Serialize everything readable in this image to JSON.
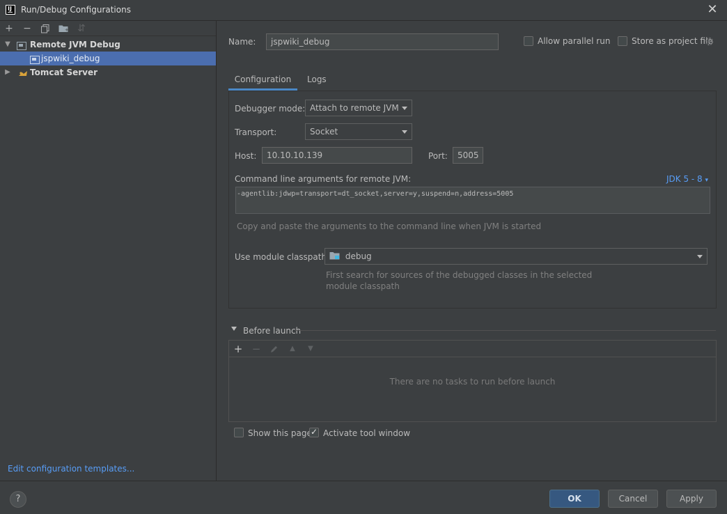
{
  "window": {
    "title": "Run/Debug Configurations",
    "logo_text": "IJ"
  },
  "left": {
    "toolbar": [
      {
        "name": "add-icon",
        "glyph": "+",
        "enabled": true
      },
      {
        "name": "remove-icon",
        "glyph": "−",
        "enabled": true
      },
      {
        "name": "copy-icon",
        "glyph": "⧉",
        "enabled": true
      },
      {
        "name": "folder-icon",
        "glyph": "▣",
        "enabled": true
      },
      {
        "name": "sort-icon",
        "glyph": "⇵",
        "enabled": false
      }
    ],
    "tree": [
      {
        "label": "Remote JVM Debug",
        "bold": true,
        "expanded": true,
        "level": 0,
        "icon": "remote-debug-icon"
      },
      {
        "label": "jspwiki_debug",
        "bold": false,
        "selected": true,
        "level": 1,
        "icon": "config-icon"
      },
      {
        "label": "Tomcat Server",
        "bold": true,
        "expanded": false,
        "level": 0,
        "icon": "tomcat-icon"
      }
    ],
    "edit_templates": "Edit configuration templates..."
  },
  "right": {
    "name_label": "Name:",
    "name_value": "jspwiki_debug",
    "allow_parallel": {
      "label": "Allow parallel run",
      "checked": false
    },
    "store_project": {
      "label": "Store as project file",
      "checked": false
    },
    "tabs": [
      {
        "label": "Configuration",
        "active": true
      },
      {
        "label": "Logs",
        "active": false
      }
    ],
    "debugger_mode": {
      "label": "Debugger mode:",
      "value": "Attach to remote JVM"
    },
    "transport": {
      "label": "Transport:",
      "value": "Socket"
    },
    "host": {
      "label": "Host:",
      "value": "10.10.10.139"
    },
    "port": {
      "label": "Port:",
      "value": "5005"
    },
    "cmd_label": "Command line arguments for remote JVM:",
    "jdk_link": "JDK 5 - 8",
    "cmd_value": "-agentlib:jdwp=transport=dt_socket,server=y,suspend=n,address=5005",
    "cmd_hint": "Copy and paste the arguments to the command line when JVM is started",
    "module": {
      "label": "Use module classpath:",
      "value": "debug"
    },
    "module_hint_1": "First search for sources of the debugged classes in the selected",
    "module_hint_2": "module classpath",
    "before_launch": "Before launch",
    "no_tasks": "There are no tasks to run before launch",
    "show_page": {
      "label": "Show this page",
      "checked": false
    },
    "activate_tool": {
      "label": "Activate tool window",
      "checked": true
    }
  },
  "buttons": {
    "help": "?",
    "ok": "OK",
    "cancel": "Cancel",
    "apply": "Apply"
  },
  "colors": {
    "accent": "#4a88c7",
    "selection": "#4b6eaf",
    "link": "#589df6",
    "primary_button": "#365880"
  }
}
